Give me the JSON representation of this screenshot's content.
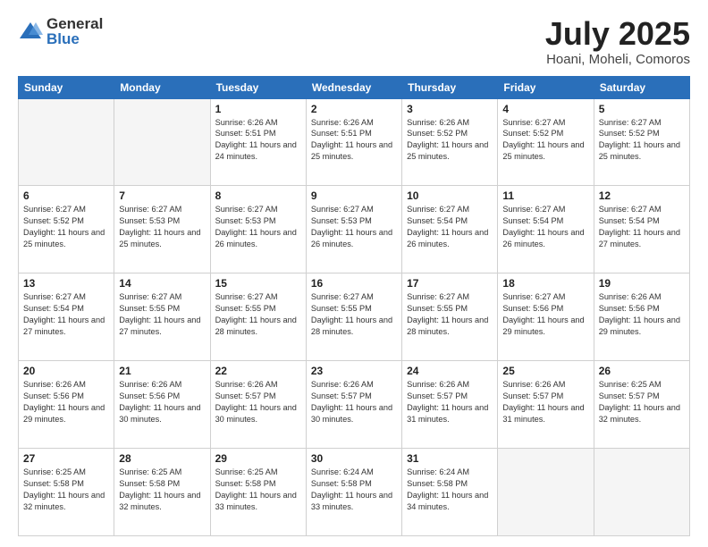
{
  "logo": {
    "general": "General",
    "blue": "Blue"
  },
  "title": {
    "month_year": "July 2025",
    "location": "Hoani, Moheli, Comoros"
  },
  "headers": [
    "Sunday",
    "Monday",
    "Tuesday",
    "Wednesday",
    "Thursday",
    "Friday",
    "Saturday"
  ],
  "weeks": [
    [
      {
        "day": "",
        "empty": true
      },
      {
        "day": "",
        "empty": true
      },
      {
        "day": "1",
        "sunrise": "Sunrise: 6:26 AM",
        "sunset": "Sunset: 5:51 PM",
        "daylight": "Daylight: 11 hours and 24 minutes."
      },
      {
        "day": "2",
        "sunrise": "Sunrise: 6:26 AM",
        "sunset": "Sunset: 5:51 PM",
        "daylight": "Daylight: 11 hours and 25 minutes."
      },
      {
        "day": "3",
        "sunrise": "Sunrise: 6:26 AM",
        "sunset": "Sunset: 5:52 PM",
        "daylight": "Daylight: 11 hours and 25 minutes."
      },
      {
        "day": "4",
        "sunrise": "Sunrise: 6:27 AM",
        "sunset": "Sunset: 5:52 PM",
        "daylight": "Daylight: 11 hours and 25 minutes."
      },
      {
        "day": "5",
        "sunrise": "Sunrise: 6:27 AM",
        "sunset": "Sunset: 5:52 PM",
        "daylight": "Daylight: 11 hours and 25 minutes."
      }
    ],
    [
      {
        "day": "6",
        "sunrise": "Sunrise: 6:27 AM",
        "sunset": "Sunset: 5:52 PM",
        "daylight": "Daylight: 11 hours and 25 minutes."
      },
      {
        "day": "7",
        "sunrise": "Sunrise: 6:27 AM",
        "sunset": "Sunset: 5:53 PM",
        "daylight": "Daylight: 11 hours and 25 minutes."
      },
      {
        "day": "8",
        "sunrise": "Sunrise: 6:27 AM",
        "sunset": "Sunset: 5:53 PM",
        "daylight": "Daylight: 11 hours and 26 minutes."
      },
      {
        "day": "9",
        "sunrise": "Sunrise: 6:27 AM",
        "sunset": "Sunset: 5:53 PM",
        "daylight": "Daylight: 11 hours and 26 minutes."
      },
      {
        "day": "10",
        "sunrise": "Sunrise: 6:27 AM",
        "sunset": "Sunset: 5:54 PM",
        "daylight": "Daylight: 11 hours and 26 minutes."
      },
      {
        "day": "11",
        "sunrise": "Sunrise: 6:27 AM",
        "sunset": "Sunset: 5:54 PM",
        "daylight": "Daylight: 11 hours and 26 minutes."
      },
      {
        "day": "12",
        "sunrise": "Sunrise: 6:27 AM",
        "sunset": "Sunset: 5:54 PM",
        "daylight": "Daylight: 11 hours and 27 minutes."
      }
    ],
    [
      {
        "day": "13",
        "sunrise": "Sunrise: 6:27 AM",
        "sunset": "Sunset: 5:54 PM",
        "daylight": "Daylight: 11 hours and 27 minutes."
      },
      {
        "day": "14",
        "sunrise": "Sunrise: 6:27 AM",
        "sunset": "Sunset: 5:55 PM",
        "daylight": "Daylight: 11 hours and 27 minutes."
      },
      {
        "day": "15",
        "sunrise": "Sunrise: 6:27 AM",
        "sunset": "Sunset: 5:55 PM",
        "daylight": "Daylight: 11 hours and 28 minutes."
      },
      {
        "day": "16",
        "sunrise": "Sunrise: 6:27 AM",
        "sunset": "Sunset: 5:55 PM",
        "daylight": "Daylight: 11 hours and 28 minutes."
      },
      {
        "day": "17",
        "sunrise": "Sunrise: 6:27 AM",
        "sunset": "Sunset: 5:55 PM",
        "daylight": "Daylight: 11 hours and 28 minutes."
      },
      {
        "day": "18",
        "sunrise": "Sunrise: 6:27 AM",
        "sunset": "Sunset: 5:56 PM",
        "daylight": "Daylight: 11 hours and 29 minutes."
      },
      {
        "day": "19",
        "sunrise": "Sunrise: 6:26 AM",
        "sunset": "Sunset: 5:56 PM",
        "daylight": "Daylight: 11 hours and 29 minutes."
      }
    ],
    [
      {
        "day": "20",
        "sunrise": "Sunrise: 6:26 AM",
        "sunset": "Sunset: 5:56 PM",
        "daylight": "Daylight: 11 hours and 29 minutes."
      },
      {
        "day": "21",
        "sunrise": "Sunrise: 6:26 AM",
        "sunset": "Sunset: 5:56 PM",
        "daylight": "Daylight: 11 hours and 30 minutes."
      },
      {
        "day": "22",
        "sunrise": "Sunrise: 6:26 AM",
        "sunset": "Sunset: 5:57 PM",
        "daylight": "Daylight: 11 hours and 30 minutes."
      },
      {
        "day": "23",
        "sunrise": "Sunrise: 6:26 AM",
        "sunset": "Sunset: 5:57 PM",
        "daylight": "Daylight: 11 hours and 30 minutes."
      },
      {
        "day": "24",
        "sunrise": "Sunrise: 6:26 AM",
        "sunset": "Sunset: 5:57 PM",
        "daylight": "Daylight: 11 hours and 31 minutes."
      },
      {
        "day": "25",
        "sunrise": "Sunrise: 6:26 AM",
        "sunset": "Sunset: 5:57 PM",
        "daylight": "Daylight: 11 hours and 31 minutes."
      },
      {
        "day": "26",
        "sunrise": "Sunrise: 6:25 AM",
        "sunset": "Sunset: 5:57 PM",
        "daylight": "Daylight: 11 hours and 32 minutes."
      }
    ],
    [
      {
        "day": "27",
        "sunrise": "Sunrise: 6:25 AM",
        "sunset": "Sunset: 5:58 PM",
        "daylight": "Daylight: 11 hours and 32 minutes."
      },
      {
        "day": "28",
        "sunrise": "Sunrise: 6:25 AM",
        "sunset": "Sunset: 5:58 PM",
        "daylight": "Daylight: 11 hours and 32 minutes."
      },
      {
        "day": "29",
        "sunrise": "Sunrise: 6:25 AM",
        "sunset": "Sunset: 5:58 PM",
        "daylight": "Daylight: 11 hours and 33 minutes."
      },
      {
        "day": "30",
        "sunrise": "Sunrise: 6:24 AM",
        "sunset": "Sunset: 5:58 PM",
        "daylight": "Daylight: 11 hours and 33 minutes."
      },
      {
        "day": "31",
        "sunrise": "Sunrise: 6:24 AM",
        "sunset": "Sunset: 5:58 PM",
        "daylight": "Daylight: 11 hours and 34 minutes."
      },
      {
        "day": "",
        "empty": true
      },
      {
        "day": "",
        "empty": true
      }
    ]
  ]
}
